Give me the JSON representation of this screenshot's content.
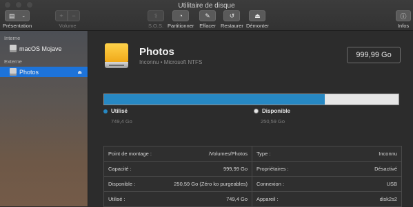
{
  "window": {
    "title": "Utilitaire de disque"
  },
  "toolbar": {
    "presentation": "Présentation",
    "volume": "Volume",
    "sos": "S.O.S.",
    "partition": "Partitionner",
    "erase": "Effacer",
    "restore": "Restaurer",
    "unmount": "Démonter",
    "info": "Infos"
  },
  "sidebar": {
    "internal_heading": "Interne",
    "internal_item": "macOS Mojave",
    "external_heading": "Externe",
    "external_item": "Photos"
  },
  "volume": {
    "name": "Photos",
    "subtitle": "Inconnu • Microsoft NTFS",
    "size": "999,99 Go"
  },
  "usage": {
    "used_fraction": 0.75,
    "used_label": "Utilisé",
    "used_value": "749,4 Go",
    "available_label": "Disponible",
    "available_value": "250,59 Go",
    "used_color": "#2788c3",
    "available_color": "#e6e6e6"
  },
  "details": {
    "left": [
      {
        "key": "Point de montage :",
        "value": "/Volumes/Photos"
      },
      {
        "key": "Capacité :",
        "value": "999,99 Go"
      },
      {
        "key": "Disponible :",
        "value": "250,59 Go (Zéro ko purgeables)"
      },
      {
        "key": "Utilisé :",
        "value": "749,4 Go"
      }
    ],
    "right": [
      {
        "key": "Type :",
        "value": "Inconnu"
      },
      {
        "key": "Propriétaires :",
        "value": "Désactivé"
      },
      {
        "key": "Connexion :",
        "value": "USB"
      },
      {
        "key": "Appareil :",
        "value": "disk2s2"
      }
    ]
  }
}
